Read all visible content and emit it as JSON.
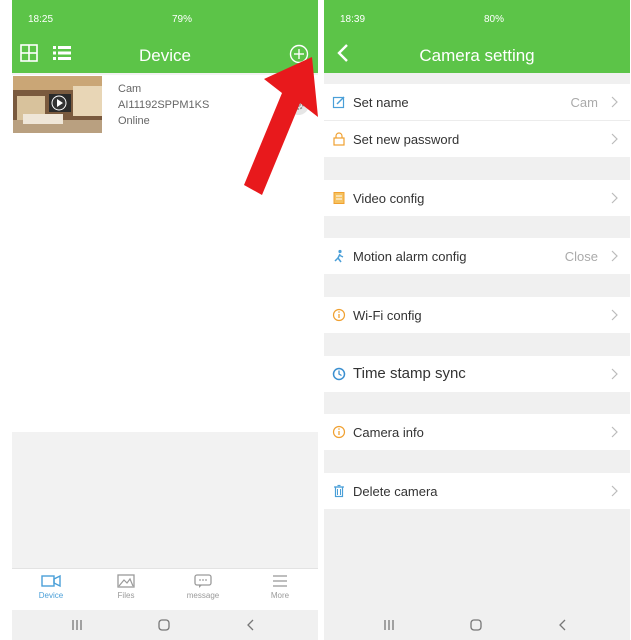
{
  "left": {
    "status": {
      "time": "18:25",
      "battery": "79%"
    },
    "title": "Device",
    "device": {
      "name": "Cam",
      "id": "AI11192SPPM1KS",
      "status": "Online"
    },
    "tabs": [
      {
        "label": "Device",
        "icon": "camera-icon",
        "active": true
      },
      {
        "label": "Files",
        "icon": "image-icon",
        "active": false
      },
      {
        "label": "message",
        "icon": "message-icon",
        "active": false
      },
      {
        "label": "More",
        "icon": "menu-icon",
        "active": false
      }
    ]
  },
  "right": {
    "status": {
      "time": "18:39",
      "battery": "80%"
    },
    "title": "Camera setting",
    "rows": [
      {
        "label": "Set name",
        "value": "Cam",
        "icon": "edit-icon"
      },
      {
        "label": "Set new password",
        "value": "",
        "icon": "lock-icon"
      },
      {
        "label": "Video config",
        "value": "",
        "icon": "video-config-icon"
      },
      {
        "label": "Motion alarm config",
        "value": "Close",
        "icon": "motion-icon"
      },
      {
        "label": "Wi-Fi config",
        "value": "",
        "icon": "info-icon"
      },
      {
        "label": "Time stamp sync",
        "value": "",
        "icon": "clock-icon"
      },
      {
        "label": "Camera info",
        "value": "",
        "icon": "info-icon"
      },
      {
        "label": "Delete camera",
        "value": "",
        "icon": "trash-icon"
      }
    ]
  },
  "colors": {
    "green": "#5cc448",
    "accent_blue": "#4a9fd8",
    "arrow_red": "#e8191c",
    "orange": "#f0a030"
  }
}
